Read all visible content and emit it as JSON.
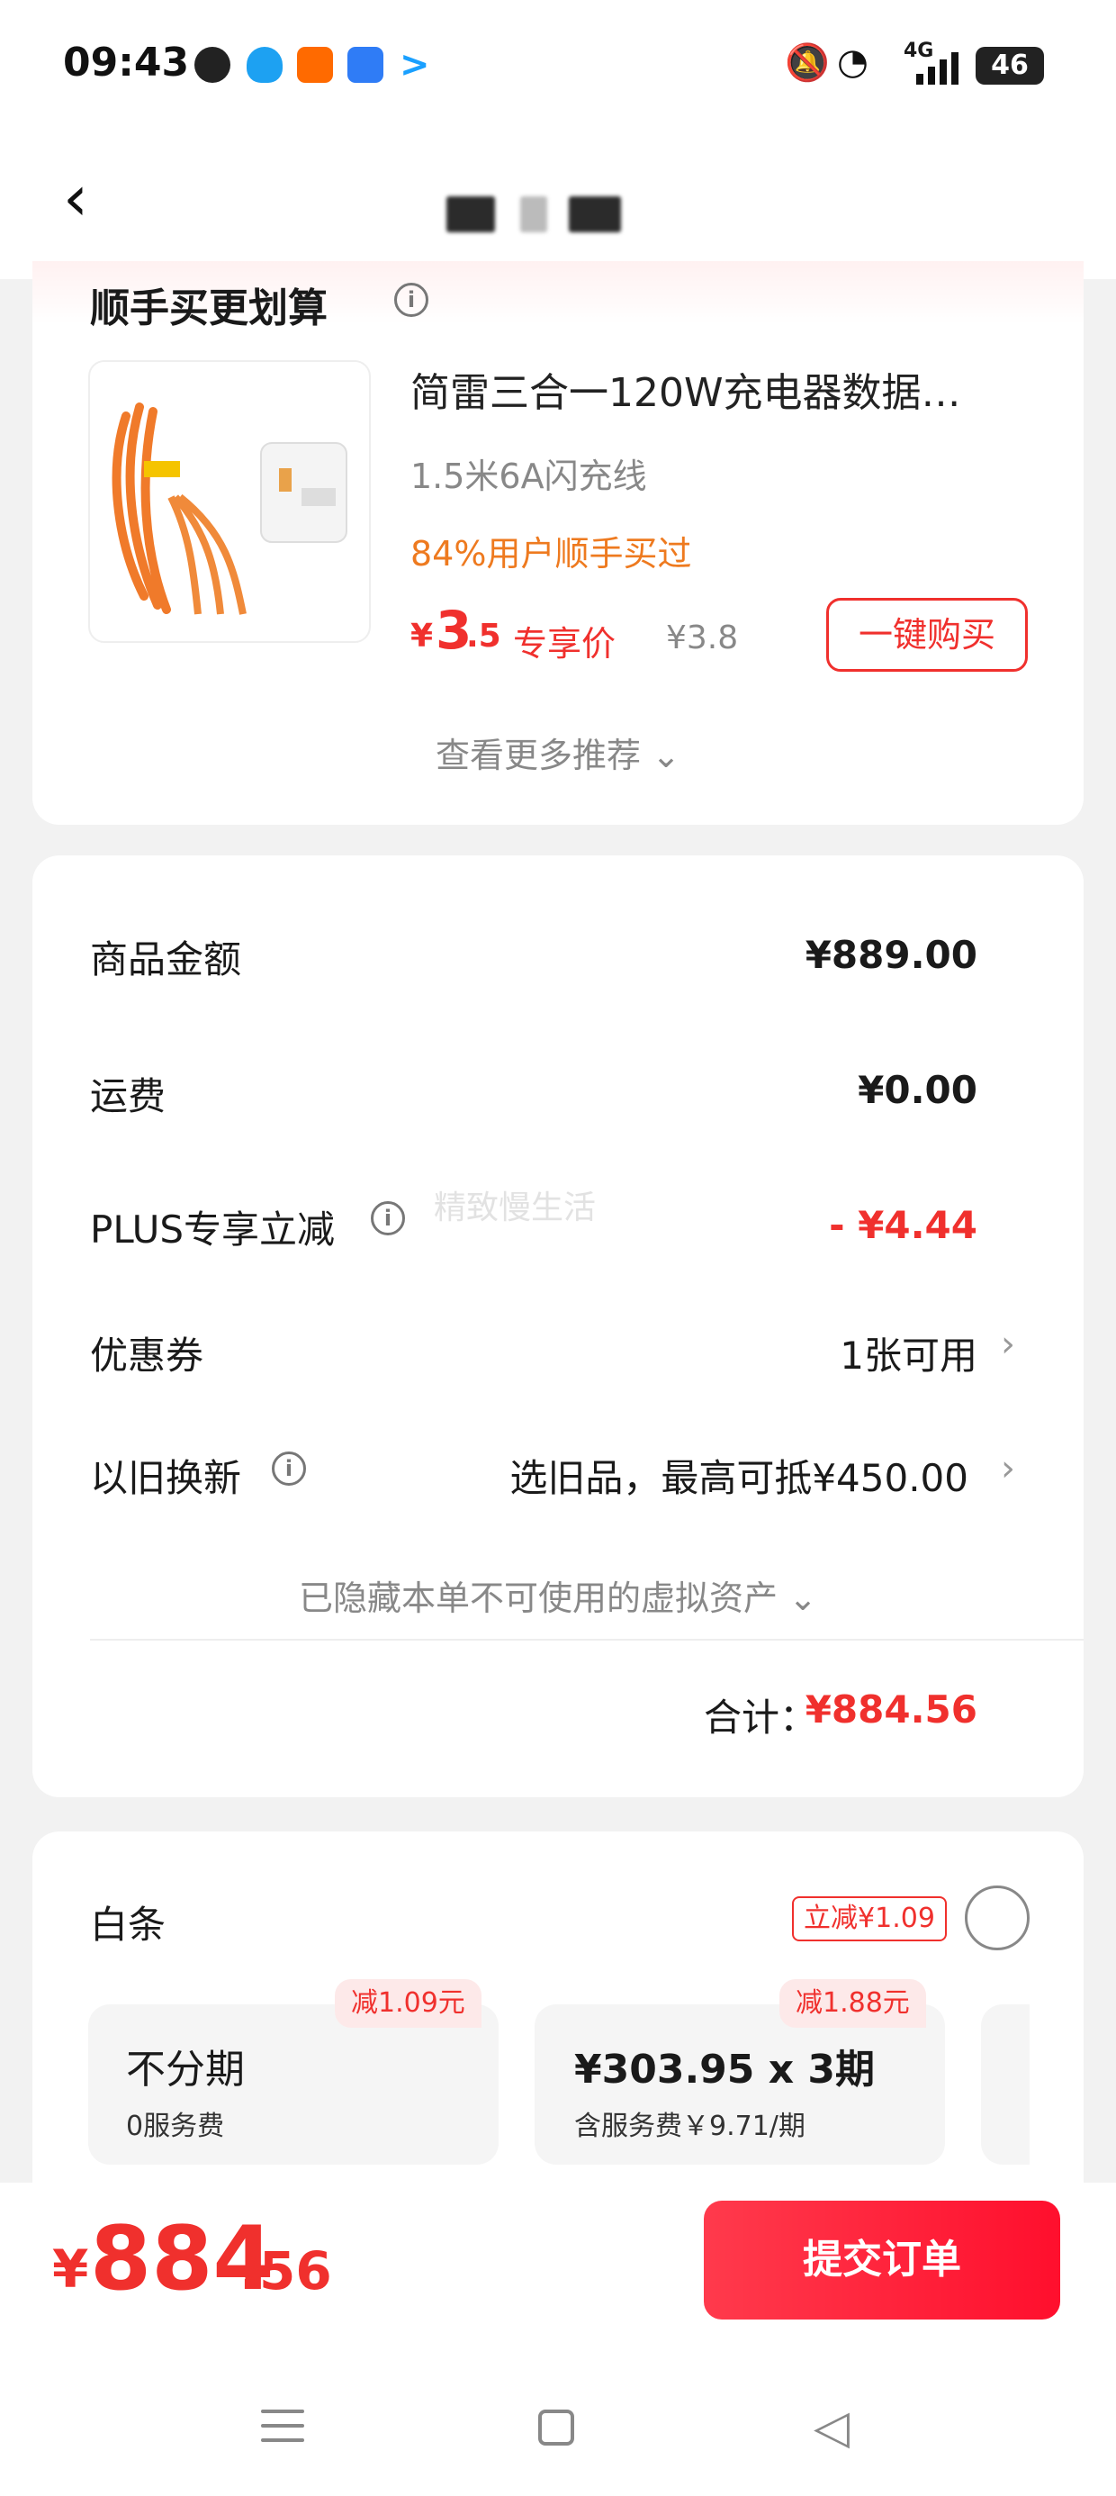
{
  "status_bar": {
    "time": "09:43",
    "network": "4G",
    "battery": "46",
    "apps": [
      "wechat-icon",
      "qq-icon",
      "taobao-icon",
      "calendar-icon",
      "arrow-app-icon"
    ]
  },
  "header": {
    "back_icon": "‹"
  },
  "recommendation": {
    "title": "顺手买更划算",
    "product": {
      "title": "简雷三合一120W充电器数据…",
      "spec": "1.5米6A闪充线",
      "note": "84%用户顺手买过",
      "price_symbol": "¥",
      "price_integer": "3",
      "price_decimal": ".5",
      "price_label": "专享价",
      "original_price": "¥3.8",
      "buy_button": "一键购买"
    },
    "more": "查看更多推荐 ⌄"
  },
  "summary": {
    "rows": [
      {
        "label": "商品金额",
        "value": "¥889.00"
      },
      {
        "label": "运费",
        "value": "¥0.00"
      },
      {
        "label": "PLUS专享立减",
        "value": "- ¥4.44"
      },
      {
        "label": "优惠券",
        "value": "1张可用"
      },
      {
        "label": "以旧换新",
        "value": "选旧品，最高可抵¥450.00"
      }
    ],
    "hidden_assets": "已隐藏本单不可使用的虚拟资产 ⌄",
    "total_label": "合计：",
    "total_value": "¥884.56"
  },
  "watermark": "精致慢生活",
  "payment": {
    "method": "白条",
    "discount_tag": "立减¥1.09",
    "plans": [
      {
        "tag": "减1.09元",
        "main": "不分期",
        "sub": "0服务费"
      },
      {
        "tag": "减1.88元",
        "main": "¥303.95 x 3期",
        "sub": "含服务费￥9.71/期"
      }
    ]
  },
  "bottom_bar": {
    "total_symbol": "¥",
    "total_integer": "884",
    "total_decimal": ".56",
    "submit": "提交订单"
  },
  "colors": {
    "accent_red": "#f0302d",
    "orange": "#ee7a1f",
    "background": "#f2f2f2"
  }
}
